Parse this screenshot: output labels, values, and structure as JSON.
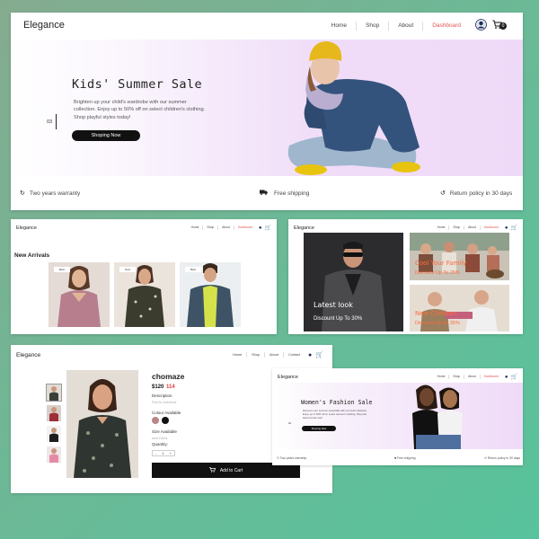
{
  "colors": {
    "accent_red": "#e05656",
    "button_dark": "#111111",
    "hero_pink": "#efd9f8",
    "background_green": "#6db896"
  },
  "icons": [
    "user-icon",
    "cart-icon",
    "refresh-icon",
    "truck-icon",
    "return-icon"
  ],
  "card1": {
    "brand": "Elegance",
    "nav": [
      "Home",
      "Shop",
      "About",
      "Dashboard"
    ],
    "cart_count": "0",
    "hero": {
      "title": "Kids' Summer Sale",
      "description": "Brighten up your child's wardrobe with our summer collection. Enjoy up to 50% off on select children's clothing. Shop playful styles today!",
      "button": "Shoping Now",
      "slide_number": "03"
    },
    "features": [
      "Two years warranty",
      "Free shipping",
      "Return policy in 30 days"
    ]
  },
  "card2": {
    "brand": "Elegance",
    "nav": [
      "Home",
      "Shop",
      "About",
      "Dashboard"
    ],
    "section_title": "New Arrivals",
    "products": [
      {
        "tag": "Best"
      },
      {
        "tag": "New"
      },
      {
        "tag": "Best"
      }
    ]
  },
  "card3": {
    "brand": "Elegance",
    "nav": [
      "Home",
      "Shop",
      "About",
      "Dashboard"
    ],
    "tiles": [
      {
        "title": "Latest look",
        "subtitle": "Discount Up To 30%"
      },
      {
        "title": "Cool Your Family",
        "subtitle": "Discount Up To 25%"
      },
      {
        "title": "New Children",
        "subtitle": "Discount Up To 35%"
      }
    ]
  },
  "card4": {
    "brand": "Elegance",
    "nav": [
      "Home",
      "Shop",
      "About",
      "Contact"
    ],
    "product": {
      "name": "chomaze",
      "price_old": "$120",
      "price_new": "114",
      "description_label": "Description",
      "description_text": "Pink for Undertone",
      "colour_label": "Colour Available",
      "size_label": "Size Available",
      "size_note": "wear Fabric",
      "quantity_label": "Quantity:",
      "quantity": "1",
      "minus": "-",
      "plus": "+",
      "add_to_cart": "Add to Cart"
    }
  },
  "card5": {
    "brand": "Elegance",
    "nav": [
      "Home",
      "Shop",
      "About",
      "Dashboard"
    ],
    "hero": {
      "title": "Women's Fashion Sale",
      "description": "Discover your summer essentials with our fresh collection. Enjoy up to 50% off on select women's clothing. Shop the latest trends now!",
      "button": "Shoping Now",
      "slide_number": "02"
    },
    "features": [
      "Two years warranty",
      "Free shipping",
      "Return policy in 30 days"
    ]
  }
}
